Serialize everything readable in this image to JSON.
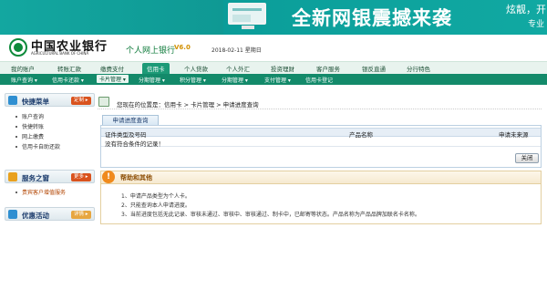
{
  "banner": {
    "slogan": "全新网银震撼来袭",
    "side_text_1": "炫靓，开",
    "side_text_2": "专业"
  },
  "header": {
    "bank_name": "中国农业银行",
    "bank_name_en": "AGRICULTURAL BANK OF CHINA",
    "site_title": "个人网上银行",
    "version": "V6.0",
    "date": "2018-02-11 星期日"
  },
  "nav_main": [
    {
      "label": "我的账户"
    },
    {
      "label": "转账汇款"
    },
    {
      "label": "缴费支付"
    },
    {
      "label": "信用卡"
    },
    {
      "label": "个人贷款"
    },
    {
      "label": "个人外汇"
    },
    {
      "label": "投资理财"
    },
    {
      "label": "客户服务"
    },
    {
      "label": "银反直通"
    },
    {
      "label": "分行特色"
    }
  ],
  "nav_sub": [
    {
      "label": "账户查询 ▾"
    },
    {
      "label": "信用卡还款 ▾"
    },
    {
      "label": "卡片管理 ▾"
    },
    {
      "label": "分期管理 ▾"
    },
    {
      "label": "积分管理 ▾"
    },
    {
      "label": "分期管理 ▾"
    },
    {
      "label": "支付管理 ▾"
    },
    {
      "label": "信用卡登记"
    }
  ],
  "sidebar": {
    "quick_menu": {
      "title": "快捷菜单",
      "button": "定制 ▸",
      "items": [
        "账户查询",
        "快捷转账",
        "网上缴费",
        "信用卡自助还款"
      ]
    },
    "service": {
      "title": "服务之窗",
      "button": "更多 ▸",
      "items": [
        "贵宾客户增值服务"
      ]
    },
    "promo": {
      "title": "优惠活动",
      "button": "详情 ▸"
    }
  },
  "location": {
    "text": "您现在的位置是：信用卡 > 卡片管理 > 申请进度查询"
  },
  "tab": {
    "label": "申请进度查询"
  },
  "grid": {
    "columns": [
      "证件类型及号码",
      "产品名称",
      "申请未来源"
    ],
    "empty_text": "没有符合条件的记录！"
  },
  "close_button": {
    "label": "关闭"
  },
  "help": {
    "title": "帮助和其他",
    "lines": [
      "1、申请产品类型为个人卡。",
      "2、只能查询本人申请进度。",
      "3、当前进度包括无此记录、审核未通过、审核中、审核通过、制卡中，已邮寄等状态。产品名称为产品品牌加联名卡名称。"
    ]
  },
  "colors": {
    "nav_dark": "#138a6a",
    "accent_green": "#1c9a77",
    "help_orange": "#f08a1c"
  }
}
